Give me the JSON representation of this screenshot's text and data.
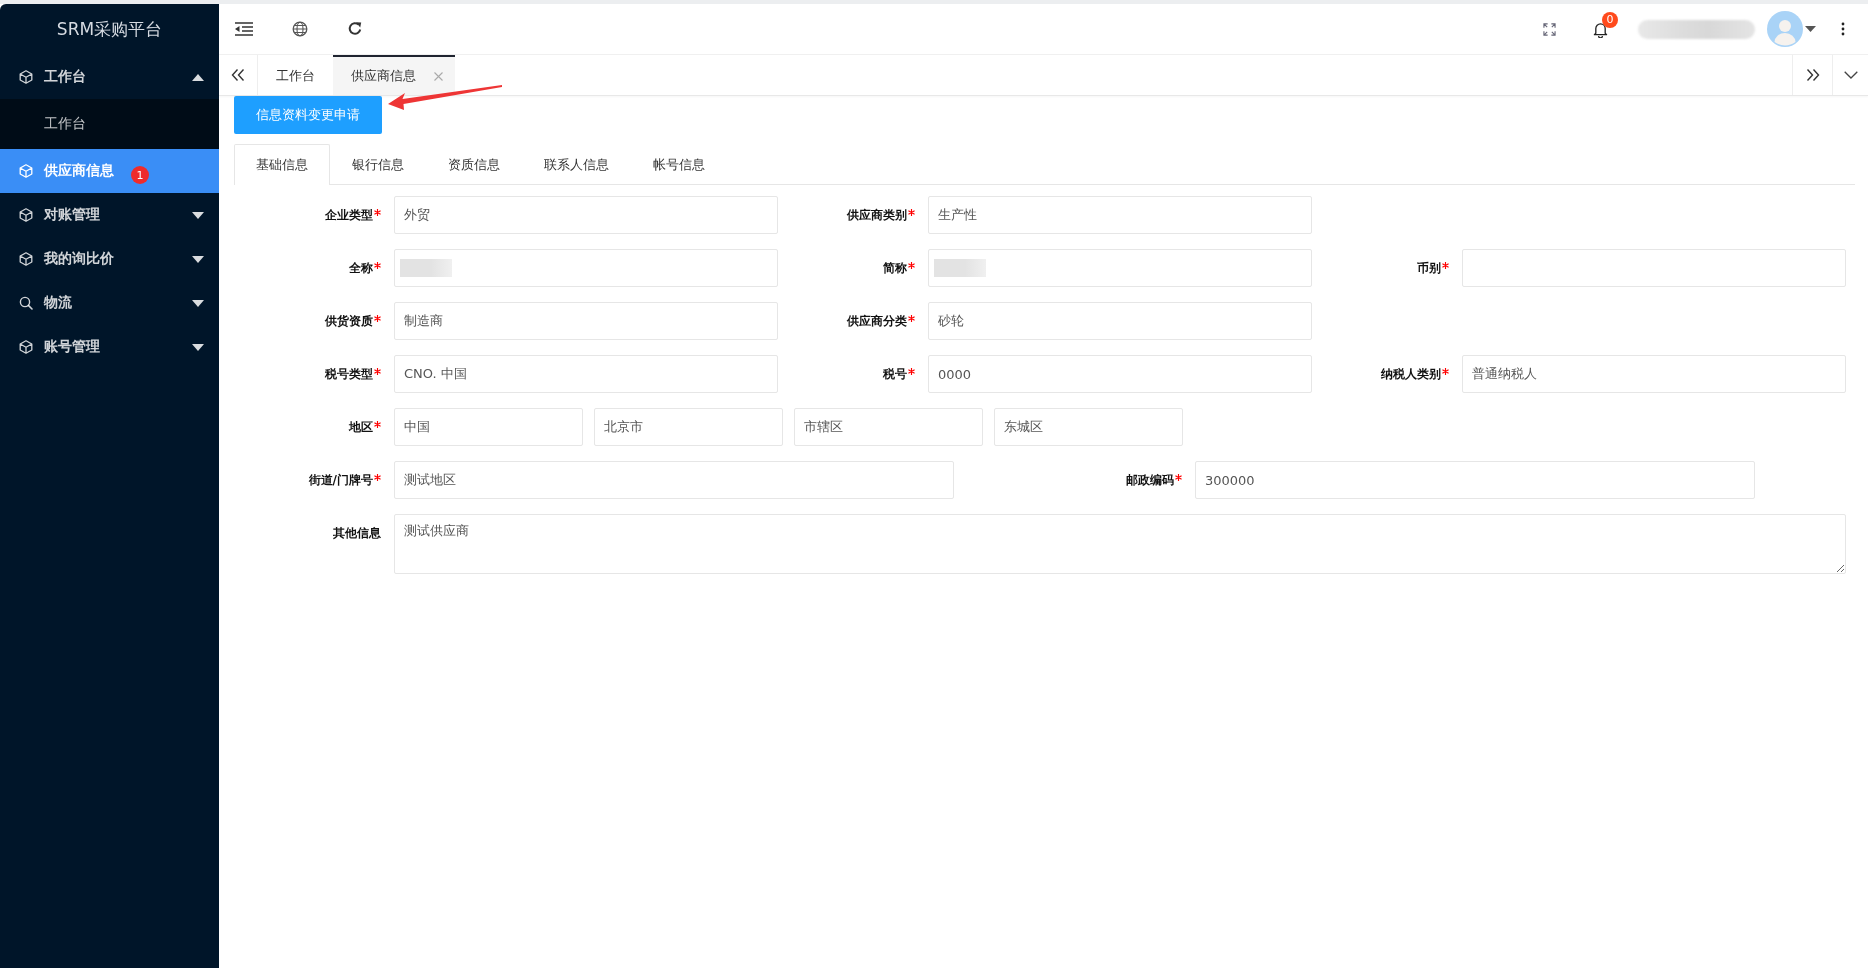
{
  "sidebar": {
    "title": "SRM采购平台",
    "items": [
      {
        "label": "工作台",
        "selected": false,
        "expanded": true,
        "children": [
          {
            "label": "工作台",
            "selected": false
          }
        ]
      },
      {
        "label": "供应商信息",
        "selected": true,
        "badge": "1"
      },
      {
        "label": "对账管理",
        "selected": false,
        "expanded": false
      },
      {
        "label": "我的询比价",
        "selected": false,
        "expanded": false
      },
      {
        "label": "物流",
        "selected": false,
        "expanded": false
      },
      {
        "label": "账号管理",
        "selected": false,
        "expanded": false
      }
    ]
  },
  "header": {
    "notification_count": "0",
    "user": {
      "name_redacted": true
    }
  },
  "page_tabs": [
    {
      "label": "工作台",
      "selected": false,
      "closable": false
    },
    {
      "label": "供应商信息",
      "selected": true,
      "closable": true
    }
  ],
  "action_button": {
    "label": "信息资料变更申请"
  },
  "detail_tabs": [
    {
      "label": "基础信息",
      "selected": true
    },
    {
      "label": "银行信息",
      "selected": false
    },
    {
      "label": "资质信息",
      "selected": false
    },
    {
      "label": "联系人信息",
      "selected": false
    },
    {
      "label": "帐号信息",
      "selected": false
    }
  ],
  "form": {
    "rows": [
      {
        "items": [
          {
            "kind": "input",
            "label": "企业类型",
            "required": true,
            "redacted": false,
            "value": "外贸"
          },
          {
            "kind": "input",
            "label": "供应商类别",
            "required": true,
            "redacted": false,
            "value": "生产性"
          }
        ]
      },
      {
        "items": [
          {
            "kind": "input",
            "label": "全称",
            "required": true,
            "redacted": true
          },
          {
            "kind": "input",
            "label": "简称",
            "required": true,
            "redacted": true
          },
          {
            "kind": "input",
            "label": "币别",
            "required": true,
            "redacted": false
          }
        ]
      },
      {
        "items": [
          {
            "kind": "input",
            "label": "供货资质",
            "required": true,
            "redacted": false,
            "value": "制造商"
          },
          {
            "kind": "input",
            "label": "供应商分类",
            "required": true,
            "redacted": false,
            "value": "砂轮"
          }
        ]
      },
      {
        "items": [
          {
            "kind": "input",
            "label": "税号类型",
            "required": true,
            "redacted": false,
            "value": "CNO. 中国"
          },
          {
            "kind": "input",
            "label": "税号",
            "required": true,
            "redacted": false,
            "value": "0000"
          },
          {
            "kind": "input",
            "label": "纳税人类别",
            "required": true,
            "redacted": false,
            "value": "普通纳税人"
          }
        ]
      },
      {
        "items": [
          {
            "kind": "region",
            "label": "地区",
            "required": true,
            "values": [
              "中国",
              "北京市",
              "市辖区",
              "东城区"
            ]
          }
        ]
      },
      {
        "items": [
          {
            "kind": "wide_input",
            "label": "街道/门牌号",
            "required": true,
            "value": "测试地区"
          },
          {
            "kind": "wide_input",
            "label": "邮政编码",
            "required": true,
            "value": "300000"
          }
        ]
      },
      {
        "items": [
          {
            "kind": "textarea",
            "label": "其他信息",
            "required": false,
            "value": "测试供应商"
          }
        ]
      }
    ]
  }
}
